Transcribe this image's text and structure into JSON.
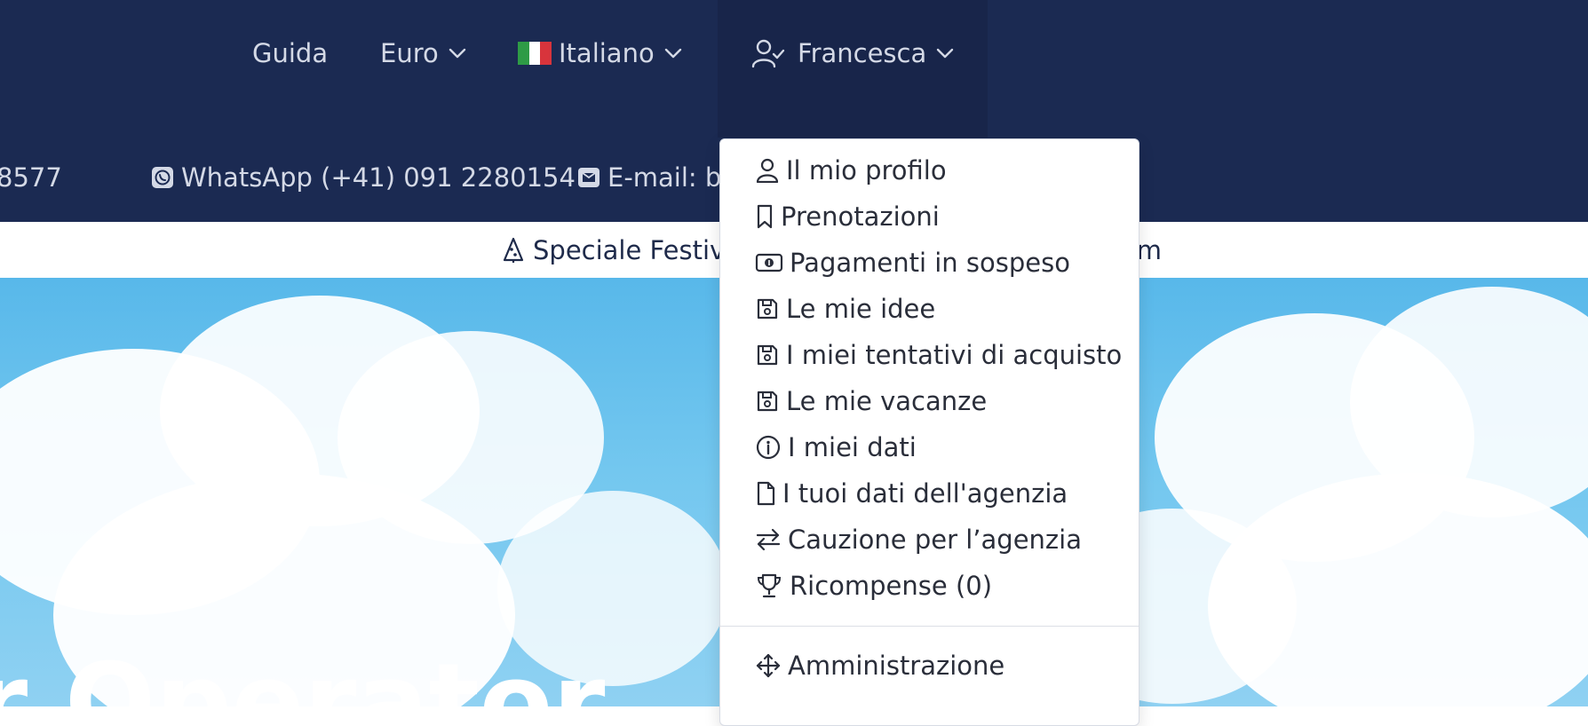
{
  "header": {
    "nav": {
      "guide_label": "Guida",
      "currency_label": "Euro",
      "language_label": "Italiano",
      "user_label": "Francesca"
    },
    "contacts": {
      "phone_partial": "8577",
      "whatsapp": "WhatsApp (+41) 091 2280154",
      "email_partial": "E-mail: b"
    }
  },
  "announcement": {
    "text_left": "Speciale Festivi",
    "text_right": "am"
  },
  "hero": {
    "title_partial": "r Operator"
  },
  "user_menu": {
    "items": [
      {
        "label": "Il mio profilo",
        "icon": "user-icon"
      },
      {
        "label": "Prenotazioni",
        "icon": "bookmark-icon"
      },
      {
        "label": "Pagamenti in sospeso",
        "icon": "cash-icon"
      },
      {
        "label": "Le mie idee",
        "icon": "floppy-icon"
      },
      {
        "label": "I miei tentativi di acquisto",
        "icon": "floppy-icon"
      },
      {
        "label": "Le mie vacanze",
        "icon": "floppy-icon"
      },
      {
        "label": "I miei dati",
        "icon": "info-icon"
      },
      {
        "label": "I tuoi dati dell'agenzia",
        "icon": "file-icon"
      },
      {
        "label": "Cauzione per l’agenzia",
        "icon": "swap-arrows-icon"
      },
      {
        "label": "Ricompense (0)",
        "icon": "trophy-icon"
      }
    ],
    "admin": {
      "label": "Amministrazione",
      "icon": "move-arrows-icon"
    }
  },
  "colors": {
    "header_bg": "#1b2a52",
    "header_text": "#d4d9e6",
    "menu_text": "#2a2e3a",
    "sky": "#5ab9ea"
  }
}
